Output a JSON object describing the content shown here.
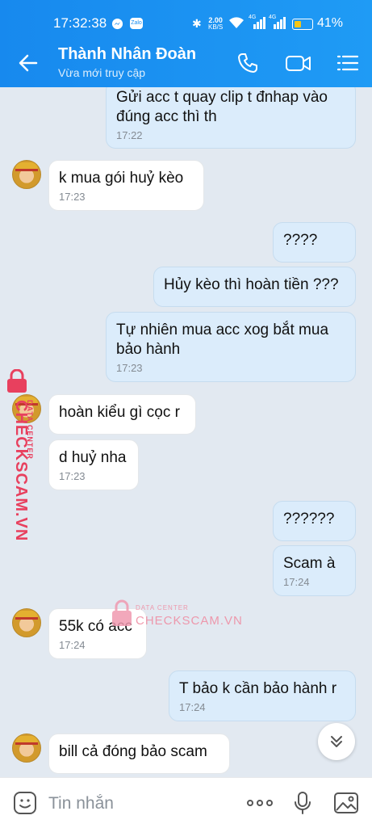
{
  "status_bar": {
    "time": "17:32:38",
    "app_icon": "Zalo",
    "net_speed": "2.00",
    "net_unit": "KB/S",
    "signal1": "4G",
    "signal2": "4G",
    "battery_pct": "41%",
    "battery_level": 0.41
  },
  "header": {
    "contact_name": "Thành Nhân Đoàn",
    "status": "Vừa mới truy cập"
  },
  "messages": [
    {
      "dir": "out",
      "text": "Gửi acc t quay clip t đnhap vào đúng acc thì th",
      "time": "17:22"
    },
    {
      "dir": "in",
      "text": "k mua gói huỷ kèo",
      "time": "17:23"
    },
    {
      "dir": "out",
      "text": "????",
      "time": ""
    },
    {
      "dir": "out",
      "text": "Hủy kèo thì hoàn tiền ???",
      "time": ""
    },
    {
      "dir": "out",
      "text": "Tự nhiên mua acc xog bắt mua bảo hành",
      "time": "17:23"
    },
    {
      "dir": "in",
      "text": "hoàn kiểu gì cọc r",
      "time": ""
    },
    {
      "dir": "in",
      "text": "d huỷ nha",
      "time": "17:23"
    },
    {
      "dir": "out",
      "text": "??????",
      "time": ""
    },
    {
      "dir": "out",
      "text": "Scam à",
      "time": "17:24"
    },
    {
      "dir": "in",
      "text": "55k có acc",
      "time": "17:24"
    },
    {
      "dir": "out",
      "text": "T bảo k cần bảo hành r",
      "time": "17:24"
    },
    {
      "dir": "in",
      "text": "bill cả đóng bảo scam",
      "time": ""
    }
  ],
  "watermark": {
    "brand": "CHECKSCAM.VN",
    "tag": "DATA CENTER"
  },
  "input": {
    "placeholder": "Tin nhắn"
  },
  "colors": {
    "header": "#1a8ef1",
    "out_bubble": "#dbecfb",
    "in_bubble": "#ffffff",
    "background": "#e2e9f1",
    "watermark": "#e8405e"
  }
}
